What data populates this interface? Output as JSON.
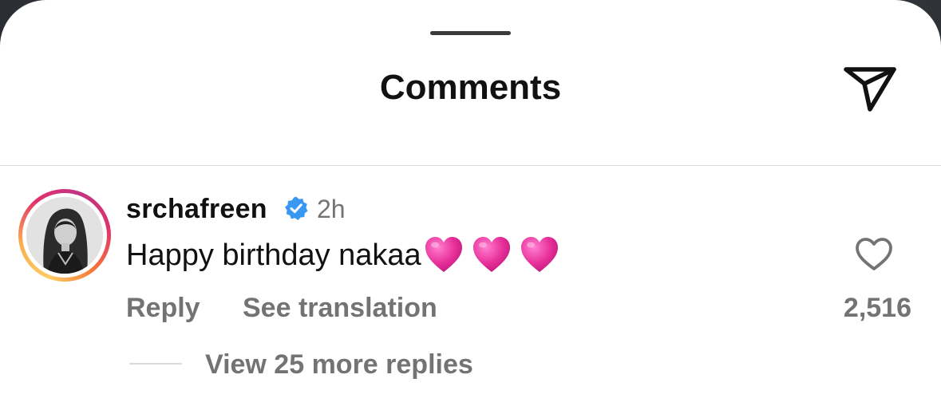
{
  "header": {
    "title": "Comments",
    "share_icon": "paper-plane-icon"
  },
  "comment": {
    "username": "srchafreen",
    "verified_icon": "verified-badge-icon",
    "verified_color": "#3897f0",
    "time": "2h",
    "text": "Happy birthday nakaa",
    "emojis": [
      "pink-heart-emoji",
      "pink-heart-emoji",
      "pink-heart-emoji"
    ],
    "reply_label": "Reply",
    "translate_label": "See translation",
    "like_icon": "heart-outline-icon",
    "like_count": "2,516",
    "view_replies_label": "View 25 more replies"
  },
  "colors": {
    "text_primary": "#111111",
    "text_secondary": "#737373",
    "heart_pink": "#e8309a",
    "divider": "#dbdbdb"
  }
}
